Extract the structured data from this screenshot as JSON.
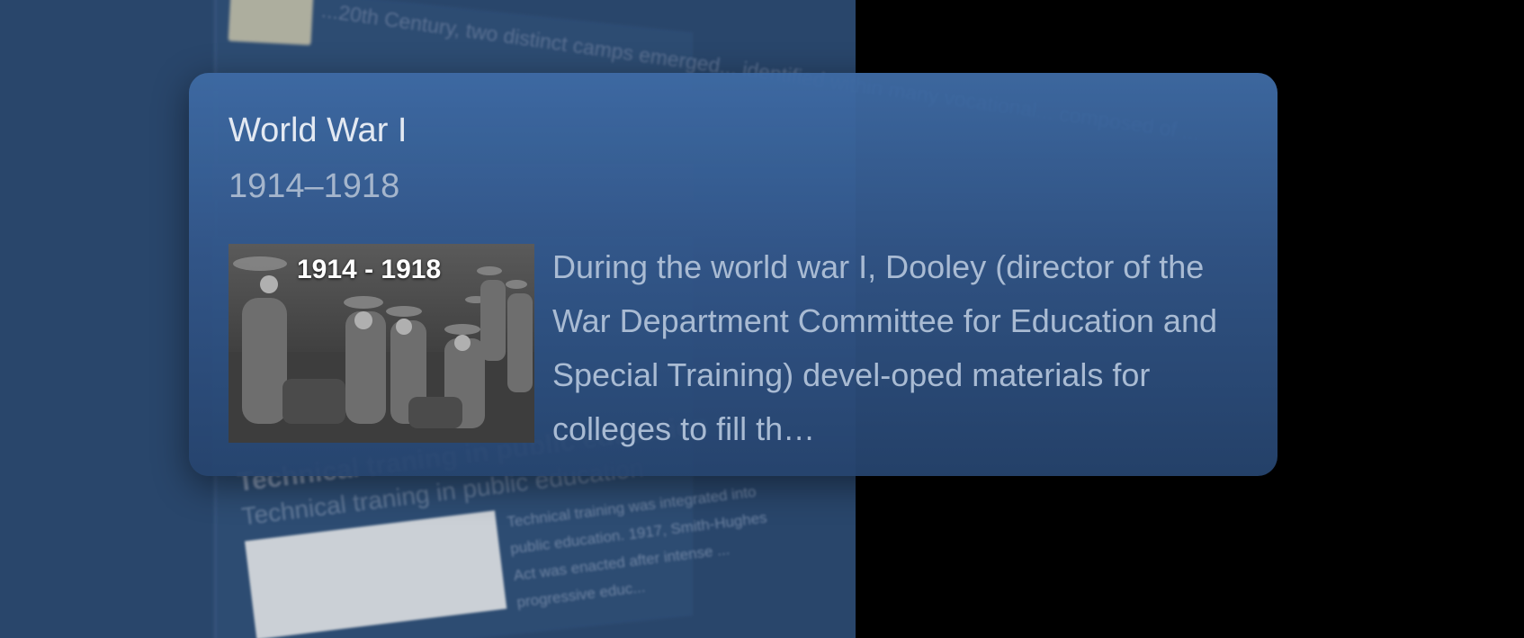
{
  "background": {
    "top_snippet": "...20th Century, two distinct camps emerged... identified within many vocational... composed of ...",
    "section_heading": "Technical traning in public education",
    "section_subheading": "Technical traning in public education",
    "section_body": "Technical training was integrated into public education. 1917, Smith-Hughes Act was enacted after intense ... progressive educ..."
  },
  "popover": {
    "title": "World War I",
    "date_range": "1914–1918",
    "image_caption": "1914 - 1918",
    "summary": "During the world war I, Dooley (director of the War Department Committee for Education and Special Training) devel-oped materials for colleges to fill th…"
  },
  "colors": {
    "card_top": "#3e6aa3",
    "card_bottom": "#26446e",
    "page_bg": "#29466b",
    "title_text": "#e3e9f2",
    "secondary_text": "#a9bbd3"
  }
}
